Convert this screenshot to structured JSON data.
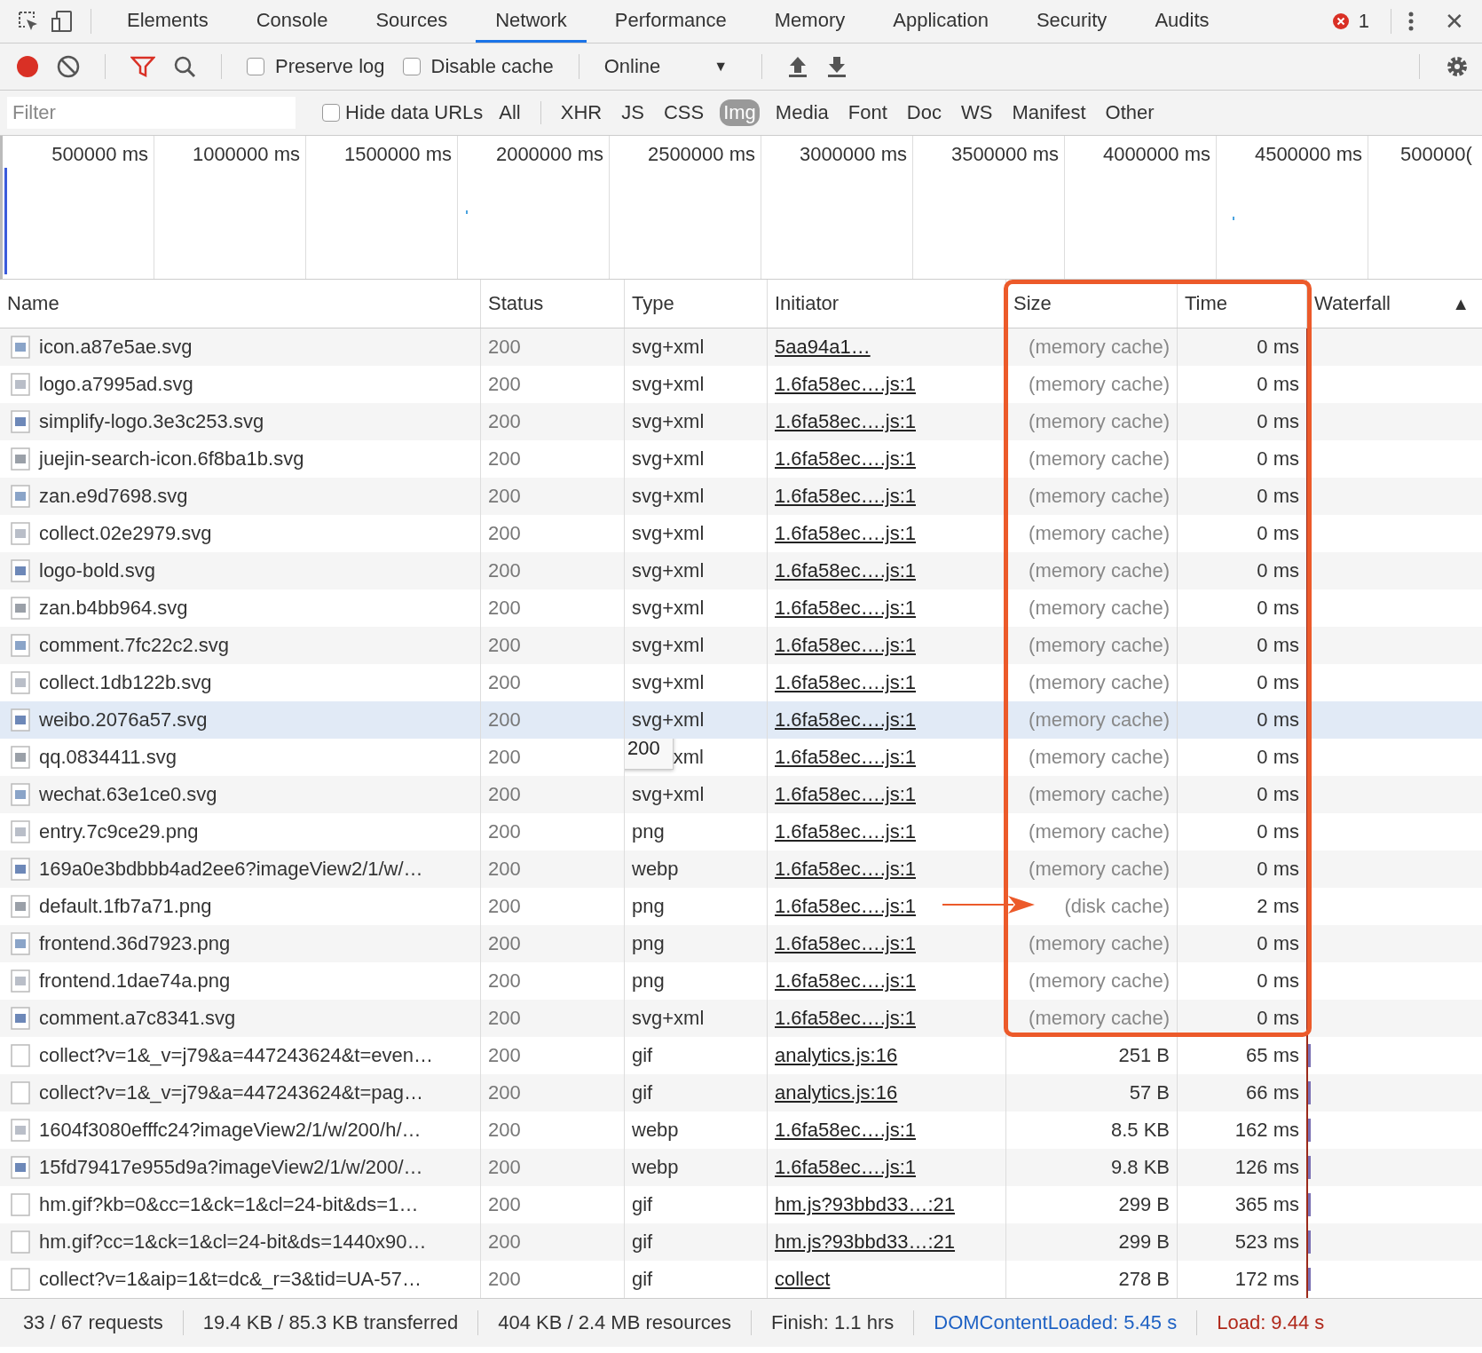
{
  "tabs": [
    {
      "label": "Elements",
      "selected": false
    },
    {
      "label": "Console",
      "selected": false
    },
    {
      "label": "Sources",
      "selected": false
    },
    {
      "label": "Network",
      "selected": true
    },
    {
      "label": "Performance",
      "selected": false
    },
    {
      "label": "Memory",
      "selected": false
    },
    {
      "label": "Application",
      "selected": false
    },
    {
      "label": "Security",
      "selected": false
    },
    {
      "label": "Audits",
      "selected": false
    }
  ],
  "error_count": "1",
  "close": "✕",
  "toolbar": {
    "recording": true,
    "filter_active": true,
    "preserve_log": {
      "label": "Preserve log",
      "checked": false
    },
    "disable_cache": {
      "label": "Disable cache",
      "checked": false
    },
    "throttling": "Online",
    "caret": "▼"
  },
  "filter_bar": {
    "placeholder": "Filter",
    "hide_data_urls": {
      "label": "Hide data URLs",
      "checked": false
    },
    "types": [
      {
        "label": "All",
        "selected": false
      },
      {
        "label": "XHR",
        "selected": false
      },
      {
        "label": "JS",
        "selected": false
      },
      {
        "label": "CSS",
        "selected": false
      },
      {
        "label": "Img",
        "selected": true
      },
      {
        "label": "Media",
        "selected": false
      },
      {
        "label": "Font",
        "selected": false
      },
      {
        "label": "Doc",
        "selected": false
      },
      {
        "label": "WS",
        "selected": false
      },
      {
        "label": "Manifest",
        "selected": false
      },
      {
        "label": "Other",
        "selected": false
      }
    ]
  },
  "overview": {
    "ticks": [
      "500000 ms",
      "1000000 ms",
      "1500000 ms",
      "2000000 ms",
      "2500000 ms",
      "3000000 ms",
      "3500000 ms",
      "4000000 ms",
      "4500000 ms",
      "500000("
    ]
  },
  "table": {
    "columns": [
      "Name",
      "Status",
      "Type",
      "Initiator",
      "Size",
      "Time",
      "Waterfall"
    ],
    "sort_indicator": "▲",
    "rows": [
      {
        "name": "icon.a87e5ae.svg",
        "kind": "thumbnail",
        "status": "200",
        "type": "svg+xml",
        "initiator": "5aa94a1…",
        "size": "(memory cache)",
        "cached": true,
        "time": "0 ms",
        "hovered": false
      },
      {
        "name": "logo.a7995ad.svg",
        "kind": "thumbnail",
        "status": "200",
        "type": "svg+xml",
        "initiator": "1.6fa58ec….js:1",
        "size": "(memory cache)",
        "cached": true,
        "time": "0 ms",
        "hovered": false
      },
      {
        "name": "simplify-logo.3e3c253.svg",
        "kind": "thumbnail",
        "status": "200",
        "type": "svg+xml",
        "initiator": "1.6fa58ec….js:1",
        "size": "(memory cache)",
        "cached": true,
        "time": "0 ms",
        "hovered": false
      },
      {
        "name": "juejin-search-icon.6f8ba1b.svg",
        "kind": "thumbnail",
        "status": "200",
        "type": "svg+xml",
        "initiator": "1.6fa58ec….js:1",
        "size": "(memory cache)",
        "cached": true,
        "time": "0 ms",
        "hovered": false
      },
      {
        "name": "zan.e9d7698.svg",
        "kind": "thumbnail",
        "status": "200",
        "type": "svg+xml",
        "initiator": "1.6fa58ec….js:1",
        "size": "(memory cache)",
        "cached": true,
        "time": "0 ms",
        "hovered": false
      },
      {
        "name": "collect.02e2979.svg",
        "kind": "thumbnail",
        "status": "200",
        "type": "svg+xml",
        "initiator": "1.6fa58ec….js:1",
        "size": "(memory cache)",
        "cached": true,
        "time": "0 ms",
        "hovered": false
      },
      {
        "name": "logo-bold.svg",
        "kind": "thumbnail",
        "status": "200",
        "type": "svg+xml",
        "initiator": "1.6fa58ec….js:1",
        "size": "(memory cache)",
        "cached": true,
        "time": "0 ms",
        "hovered": false
      },
      {
        "name": "zan.b4bb964.svg",
        "kind": "thumbnail",
        "status": "200",
        "type": "svg+xml",
        "initiator": "1.6fa58ec….js:1",
        "size": "(memory cache)",
        "cached": true,
        "time": "0 ms",
        "hovered": false
      },
      {
        "name": "comment.7fc22c2.svg",
        "kind": "thumbnail",
        "status": "200",
        "type": "svg+xml",
        "initiator": "1.6fa58ec….js:1",
        "size": "(memory cache)",
        "cached": true,
        "time": "0 ms",
        "hovered": false
      },
      {
        "name": "collect.1db122b.svg",
        "kind": "thumbnail",
        "status": "200",
        "type": "svg+xml",
        "initiator": "1.6fa58ec….js:1",
        "size": "(memory cache)",
        "cached": true,
        "time": "0 ms",
        "hovered": false
      },
      {
        "name": "weibo.2076a57.svg",
        "kind": "thumbnail",
        "status": "200",
        "type": "svg+xml",
        "initiator": "1.6fa58ec….js:1",
        "size": "(memory cache)",
        "cached": true,
        "time": "0 ms",
        "hovered": true
      },
      {
        "name": "qq.0834411.svg",
        "kind": "thumbnail",
        "status": "200",
        "type": "xml",
        "tooltip": "200",
        "initiator": "1.6fa58ec….js:1",
        "size": "(memory cache)",
        "cached": true,
        "time": "0 ms",
        "hovered": false
      },
      {
        "name": "wechat.63e1ce0.svg",
        "kind": "thumbnail",
        "status": "200",
        "type": "svg+xml",
        "initiator": "1.6fa58ec….js:1",
        "size": "(memory cache)",
        "cached": true,
        "time": "0 ms",
        "hovered": false
      },
      {
        "name": "entry.7c9ce29.png",
        "kind": "thumbnail",
        "status": "200",
        "type": "png",
        "initiator": "1.6fa58ec….js:1",
        "size": "(memory cache)",
        "cached": true,
        "time": "0 ms",
        "hovered": false
      },
      {
        "name": "169a0e3bdbbb4ad2ee6?imageView2/1/w/…",
        "kind": "thumbnail",
        "status": "200",
        "type": "webp",
        "initiator": "1.6fa58ec….js:1",
        "size": "(memory cache)",
        "cached": true,
        "time": "0 ms",
        "hovered": false
      },
      {
        "name": "default.1fb7a71.png",
        "kind": "thumbnail",
        "status": "200",
        "type": "png",
        "initiator": "1.6fa58ec….js:1",
        "size": "(disk cache)",
        "cached": true,
        "time": "2 ms",
        "hovered": false
      },
      {
        "name": "frontend.36d7923.png",
        "kind": "thumbnail",
        "status": "200",
        "type": "png",
        "initiator": "1.6fa58ec….js:1",
        "size": "(memory cache)",
        "cached": true,
        "time": "0 ms",
        "hovered": false
      },
      {
        "name": "frontend.1dae74a.png",
        "kind": "thumbnail",
        "status": "200",
        "type": "png",
        "initiator": "1.6fa58ec….js:1",
        "size": "(memory cache)",
        "cached": true,
        "time": "0 ms",
        "hovered": false
      },
      {
        "name": "comment.a7c8341.svg",
        "kind": "thumbnail",
        "status": "200",
        "type": "svg+xml",
        "initiator": "1.6fa58ec….js:1",
        "size": "(memory cache)",
        "cached": true,
        "time": "0 ms",
        "hovered": false
      },
      {
        "name": "collect?v=1&_v=j79&a=447243624&t=even…",
        "kind": "blank",
        "status": "200",
        "type": "gif",
        "initiator": "analytics.js:16",
        "size": "251 B",
        "cached": false,
        "time": "65 ms",
        "hovered": false
      },
      {
        "name": "collect?v=1&_v=j79&a=447243624&t=pag…",
        "kind": "blank",
        "status": "200",
        "type": "gif",
        "initiator": "analytics.js:16",
        "size": "57 B",
        "cached": false,
        "time": "66 ms",
        "hovered": false
      },
      {
        "name": "1604f3080efffc24?imageView2/1/w/200/h/…",
        "kind": "thumbnail",
        "status": "200",
        "type": "webp",
        "initiator": "1.6fa58ec….js:1",
        "size": "8.5 KB",
        "cached": false,
        "time": "162 ms",
        "hovered": false
      },
      {
        "name": "15fd79417e955d9a?imageView2/1/w/200/…",
        "kind": "thumbnail",
        "status": "200",
        "type": "webp",
        "initiator": "1.6fa58ec….js:1",
        "size": "9.8 KB",
        "cached": false,
        "time": "126 ms",
        "hovered": false
      },
      {
        "name": "hm.gif?kb=0&cc=1&ck=1&cl=24-bit&ds=1…",
        "kind": "blank",
        "status": "200",
        "type": "gif",
        "initiator": "hm.js?93bbd33…:21",
        "size": "299 B",
        "cached": false,
        "time": "365 ms",
        "hovered": false
      },
      {
        "name": "hm.gif?cc=1&ck=1&cl=24-bit&ds=1440x90…",
        "kind": "blank",
        "status": "200",
        "type": "gif",
        "initiator": "hm.js?93bbd33…:21",
        "size": "299 B",
        "cached": false,
        "time": "523 ms",
        "hovered": false
      },
      {
        "name": "collect?v=1&aip=1&t=dc&_r=3&tid=UA-57…",
        "kind": "blank",
        "status": "200",
        "type": "gif",
        "initiator": "collect",
        "size": "278 B",
        "cached": false,
        "time": "172 ms",
        "hovered": false
      }
    ]
  },
  "status_bar": [
    {
      "text": "33 / 67 requests",
      "color": "#333333"
    },
    {
      "text": "19.4 KB / 85.3 KB transferred",
      "color": "#333333"
    },
    {
      "text": "404 KB / 2.4 MB resources",
      "color": "#333333"
    },
    {
      "text": "Finish: 1.1 hrs",
      "color": "#333333"
    },
    {
      "text": "DOMContentLoaded: 5.45 s",
      "color": "#1f62c4"
    },
    {
      "text": "Load: 9.44 s",
      "color": "#b0281a"
    }
  ]
}
